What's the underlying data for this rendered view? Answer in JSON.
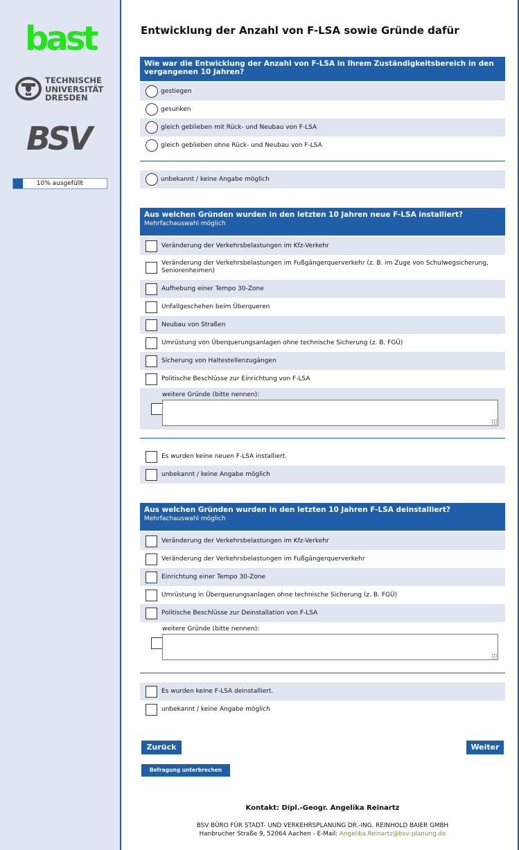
{
  "sidebar": {
    "logo_bast": "bast",
    "logo_tud_lines": [
      "TECHNISCHE",
      "UNIVERSITÄT",
      "DRESDEN"
    ],
    "logo_bsv": "BSV",
    "progress": {
      "label": "10% ausgefüllt",
      "fraction": 0.1,
      "color": "#1f5ea8"
    }
  },
  "page_title": "Entwicklung der Anzahl von F-LSA sowie Gründe dafür",
  "q1": {
    "question": "Wie war die Entwicklung der Anzahl von F-LSA in Ihrem Zuständigkeitsbereich in den vergangenen 10 Jahren?",
    "options": [
      "gestiegen",
      "gesunken",
      "gleich geblieben mit Rück- und Neubau von F-LSA",
      "gleich geblieben ohne Rück- und Neubau von F-LSA"
    ],
    "unknown": "unbekannt / keine Angabe möglich"
  },
  "q2": {
    "question": "Aus welchen Gründen wurden in den letzten 10 Jahren neue F-LSA installiert?",
    "hint": "Mehrfachauswahl möglich",
    "options": [
      "Veränderung der Verkehrsbelastungen im Kfz-Verkehr",
      "Veränderung der Verkehrsbelastungen im Fußgängerquerverkehr (z. B. im Zuge von Schulwegsicherung, Seniorenheimen)",
      "Aufhebung einer Tempo 30-Zone",
      "Unfallgeschehen beim Überqueren",
      "Neubau von Straßen",
      "Umrüstung von Überquerungsanlagen ohne technische Sicherung (z. B. FGÜ)",
      "Sicherung von Haltestellenzugängen",
      "Politische Beschlüsse zur Einrichtung von F-LSA"
    ],
    "other_label": "weitere Gründe (bitte nennen):",
    "other_value": "",
    "none": "Es wurden keine neuen F-LSA installiert.",
    "unknown": "unbekannt / keine Angabe möglich"
  },
  "q3": {
    "question": "Aus welchen Gründen wurden in den letzten 10 Jahren F-LSA deinstalliert?",
    "hint": "Mehrfachauswahl möglich",
    "options": [
      "Veränderung der Verkehrsbelastungen im Kfz-Verkehr",
      "Veränderung der Verkehrsbelastungen im Fußgängerquerverkehr",
      "Einrichtung einer Tempo 30-Zone",
      "Umrüstung in Überquerungsanlagen ohne technische Sicherung (z. B. FGÜ)",
      "Politische Beschlüsse zur Deinstallation von F-LSA"
    ],
    "other_label": "weitere Gründe (bitte nennen):",
    "other_value": "",
    "none": "Es wurden keine F-LSA deinstalliert.",
    "unknown": "unbekannt / keine Angabe möglich"
  },
  "buttons": {
    "back": "Zurück",
    "next": "Weiter",
    "abort": "Befragung unterbrechen"
  },
  "footer": {
    "contact": "Kontakt: Dipl.-Geogr. Angelika Reinartz",
    "company": "BSV BÜRO FÜR STADT- UND VERKEHRSPLANUNG DR.-ING. REINHOLD BAIER GMBH",
    "address": "Hanbrucher Straße 9, 52064 Aachen - E-Mail: ",
    "email": "Angelika.Reinartz@bsv-planung.de"
  },
  "colors": {
    "accent": "#1f5ea8",
    "row_alt": "#dfe6f1",
    "bast_green": "#22e41b",
    "mail_green": "#6aa81f"
  }
}
